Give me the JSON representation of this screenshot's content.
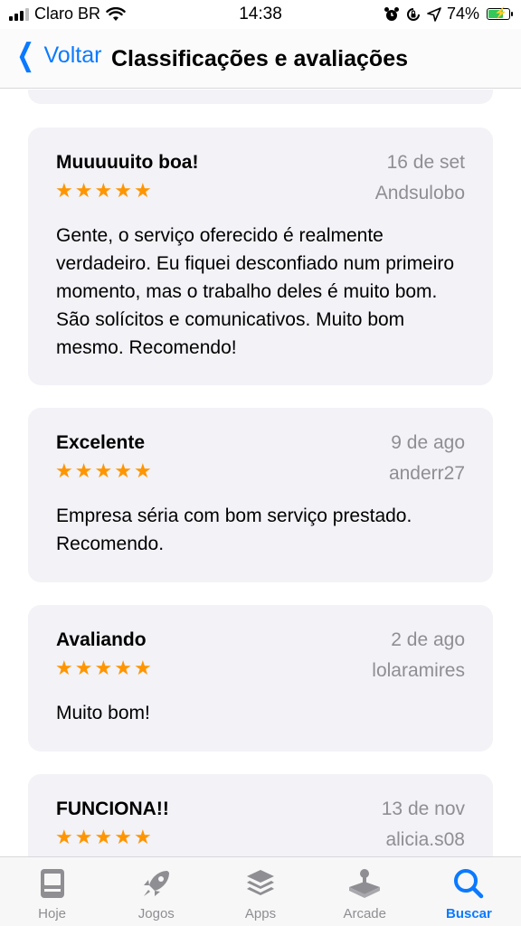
{
  "status": {
    "carrier": "Claro BR",
    "time": "14:38",
    "battery": "74%",
    "battery_level": 0.74
  },
  "nav": {
    "back_label": "Voltar",
    "title": "Classificações e avaliações"
  },
  "reviews": [
    {
      "title": "Muuuuuito boa!",
      "date": "16 de set",
      "author": "Andsulobo",
      "stars": 5,
      "body": "Gente, o serviço oferecido é realmente verdadeiro. Eu fiquei desconfiado num primeiro momento, mas o trabalho deles é muito bom. São solícitos e comunicativos. Muito bom mesmo. Recomendo!"
    },
    {
      "title": "Excelente",
      "date": "9 de ago",
      "author": "anderr27",
      "stars": 5,
      "body": "Empresa séria com bom serviço prestado. Recomendo."
    },
    {
      "title": "Avaliando",
      "date": "2 de ago",
      "author": "lolaramires",
      "stars": 5,
      "body": "Muito bom!"
    },
    {
      "title": "FUNCIONA!!",
      "date": "13 de nov",
      "author": "alicia.s08",
      "stars": 5,
      "body": ""
    }
  ],
  "tabs": [
    {
      "label": "Hoje",
      "icon": "today-icon",
      "active": false
    },
    {
      "label": "Jogos",
      "icon": "rocket-icon",
      "active": false
    },
    {
      "label": "Apps",
      "icon": "apps-stack-icon",
      "active": false
    },
    {
      "label": "Arcade",
      "icon": "joystick-icon",
      "active": false
    },
    {
      "label": "Buscar",
      "icon": "search-icon",
      "active": true
    }
  ],
  "colors": {
    "accent": "#0a7aff",
    "star": "#ff9500",
    "card": "#f2f2f7",
    "muted": "#8e8e93",
    "battery": "#34c759"
  }
}
